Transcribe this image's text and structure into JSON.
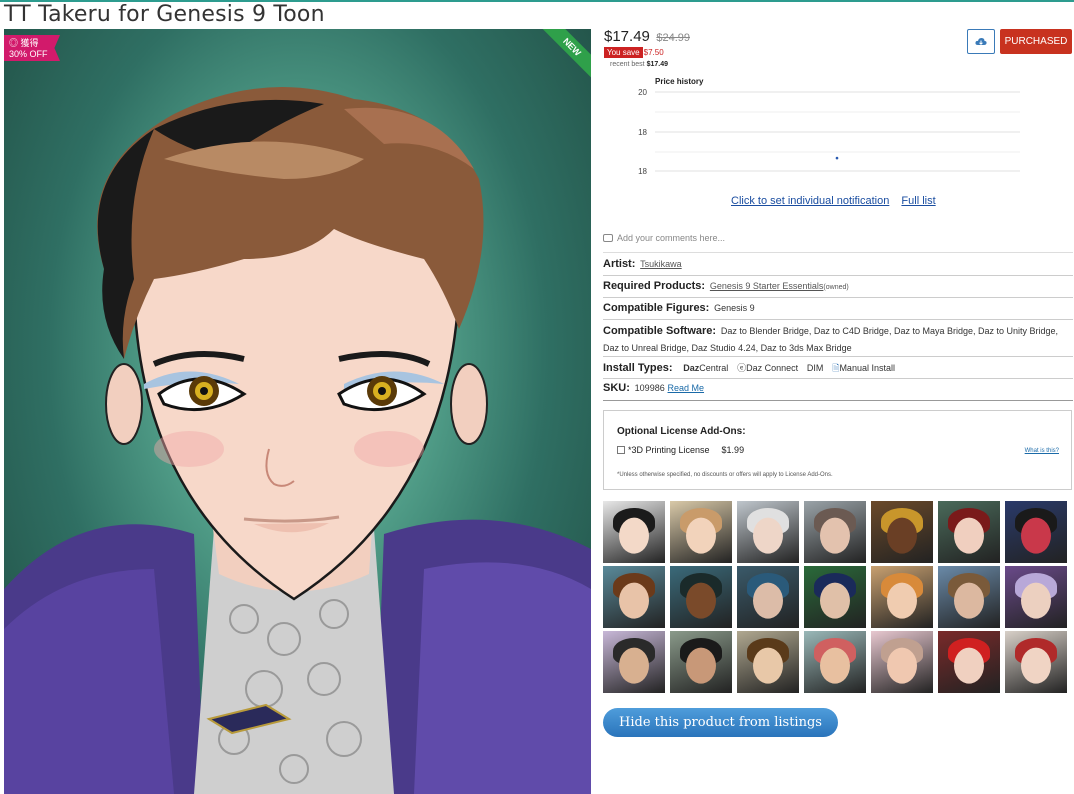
{
  "product": {
    "title": "TT Takeru for Genesis 9 Toon",
    "badge_sale": "◎ 獲得",
    "badge_off": "30% OFF",
    "badge_new": "NEW"
  },
  "pricing": {
    "price": "$17.49",
    "old_price": "$24.99",
    "you_save_label": "You save",
    "you_save_amount": "$7.50",
    "recent_best_label": "recent best",
    "recent_best_value": "$17.49"
  },
  "actions": {
    "cart_icon": "cloud-download-icon",
    "purchased_label": "PURCHASED",
    "set_notification": "Click to set individual notification",
    "full_list": "Full list",
    "hide_product": "Hide this product from listings"
  },
  "price_history": {
    "title": "Price history",
    "tick_labels": [
      "20",
      "18",
      "18"
    ]
  },
  "chart_data": {
    "type": "scatter",
    "title": "Price history",
    "ytick_labels": [
      "20",
      "18",
      "18"
    ],
    "points": [
      {
        "y": 17.49
      }
    ]
  },
  "comments": {
    "placeholder": "Add your comments here..."
  },
  "details": {
    "artist_label": "Artist:",
    "artist_value": "Tsukikawa",
    "required_label": "Required Products:",
    "required_value": "Genesis 9 Starter Essentials",
    "required_note": "(owned)",
    "figures_label": "Compatible Figures:",
    "figures_value": "Genesis 9",
    "software_label": "Compatible Software:",
    "software_value": "Daz to Blender Bridge, Daz to C4D Bridge, Daz to Maya Bridge, Daz to Unity Bridge, Daz to Unreal Bridge, Daz Studio 4.24, Daz to 3ds Max Bridge",
    "install_label": "Install Types:",
    "install_dazcentral_a": "Daz",
    "install_dazcentral_b": "Central",
    "install_dazconnect": "Daz Connect",
    "install_dim": "DIM",
    "install_manual": "Manual Install",
    "sku_label": "SKU:",
    "sku_value": "109986",
    "read_me": "Read Me"
  },
  "license": {
    "heading": "Optional License Add-Ons:",
    "option_label": "*3D Printing License",
    "option_price": "$1.99",
    "what_is_this": "What is this?",
    "note": "*Unless otherwise specified, no discounts or offers will apply to License Add-Ons."
  },
  "thumbnails": [
    {
      "bg": "#e8e8e8",
      "hair": "#1b1b1b",
      "skin": "#f3d9c8"
    },
    {
      "bg": "#d9c9a8",
      "hair": "#c99b6a",
      "skin": "#f2d3bb"
    },
    {
      "bg": "#bfc6cc",
      "hair": "#e0e0e0",
      "skin": "#eed6c8"
    },
    {
      "bg": "#9aa3a8",
      "hair": "#6b5a52",
      "skin": "#e3c2ae"
    },
    {
      "bg": "#6b4a2a",
      "hair": "#c8962b",
      "skin": "#6a3f25"
    },
    {
      "bg": "#4a6a5a",
      "hair": "#7a1a1a",
      "skin": "#f0cfbf"
    },
    {
      "bg": "#2a3a6a",
      "hair": "#1a1a1a",
      "skin": "#c9384a"
    },
    {
      "bg": "#5a8a9a",
      "hair": "#6b3a1a",
      "skin": "#e8c3a8"
    },
    {
      "bg": "#3a6a7a",
      "hair": "#1a2a2a",
      "skin": "#7a4a2a"
    },
    {
      "bg": "#3a5a6a",
      "hair": "#2a5a7a",
      "skin": "#dcbca8"
    },
    {
      "bg": "#2a6a3a",
      "hair": "#1a2a5a",
      "skin": "#e0c0a8"
    },
    {
      "bg": "#c8a070",
      "hair": "#d88a3a",
      "skin": "#f0ccb0"
    },
    {
      "bg": "#6a8aa8",
      "hair": "#7a5a3a",
      "skin": "#dcb8a0"
    },
    {
      "bg": "#6a4a8a",
      "hair": "#b8a8d8",
      "skin": "#ecd0c0"
    },
    {
      "bg": "#c8b8d8",
      "hair": "#2a2a2a",
      "skin": "#d8b090"
    },
    {
      "bg": "#8a9a8a",
      "hair": "#1a1a1a",
      "skin": "#c89878"
    },
    {
      "bg": "#b0a890",
      "hair": "#5a3a1a",
      "skin": "#e8c8a8"
    },
    {
      "bg": "#9ab8b8",
      "hair": "#d06060",
      "skin": "#e8c0a0"
    },
    {
      "bg": "#e8c8d0",
      "hair": "#c0a090",
      "skin": "#f0c8b0"
    },
    {
      "bg": "#7a2a2a",
      "hair": "#d02020",
      "skin": "#f0d0c0"
    },
    {
      "bg": "#d8d0c8",
      "hair": "#b02a2a",
      "skin": "#f0d4c4"
    }
  ]
}
